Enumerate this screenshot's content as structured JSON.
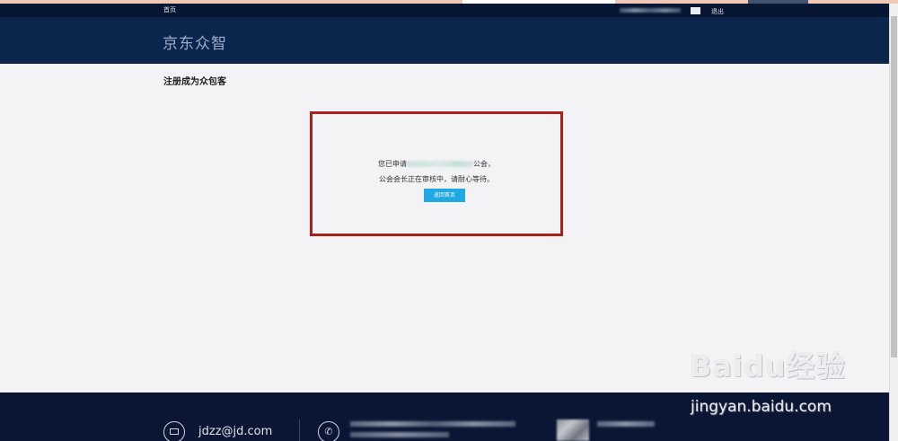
{
  "topbar": {
    "home_label": "首页",
    "logout_label": "退出"
  },
  "header": {
    "brand": "京东众智"
  },
  "main": {
    "page_title": "注册成为众包客",
    "notice": {
      "line1_prefix": "您已申请",
      "line1_suffix": "公会，",
      "line2": "公会会长正在审核中，请耐心等待。",
      "back_button": "返回首页"
    }
  },
  "footer": {
    "email": "jdzz@jd.com"
  },
  "watermark": {
    "logo_text": "Baidu经验",
    "url": "jingyan.baidu.com"
  },
  "colors": {
    "topbar_bg": "#061633",
    "header_bg": "#0c254c",
    "footer_bg": "#0a1633",
    "notice_border": "#a92219",
    "button_bg": "#20a8e3"
  }
}
